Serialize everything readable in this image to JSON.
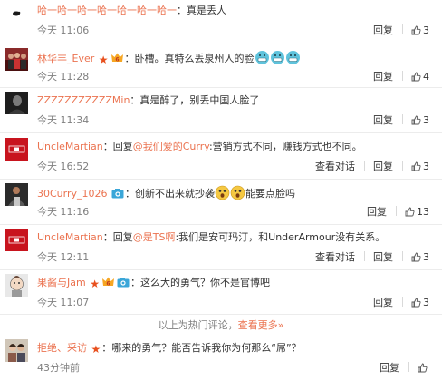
{
  "comments": [
    {
      "user": "哈一哈一哈一哈一哈一哈一哈一",
      "text": "：真是丢人",
      "time": "今天 11:06",
      "reply": "回复",
      "likes": "3",
      "avatar": "white-bird-avatar"
    },
    {
      "user": "林华丰_Ever",
      "text": "：卧槽。真特么丢泉州人的脸",
      "time": "今天 11:28",
      "reply": "回复",
      "likes": "4",
      "avatar": "group-photo-avatar"
    },
    {
      "user": "ZZZZZZZZZZZMin",
      "text": "：真是醉了，别丢中国人脸了",
      "time": "今天 11:34",
      "reply": "回复",
      "likes": "3",
      "avatar": "dark-portrait-avatar"
    },
    {
      "user": "UncleMartian",
      "text_prefix": "：回复",
      "mention": "@我们爱的Curry",
      "text": ":营销方式不同，赚钱方式也不同。",
      "time": "今天 16:52",
      "view_thread": "查看对话",
      "reply": "回复",
      "likes": "3",
      "avatar": "red-logo-avatar"
    },
    {
      "user": "30Curry_1026",
      "text": "：创新不出来就抄袭",
      "text_suffix": "能要点脸吗",
      "time": "今天 11:16",
      "reply": "回复",
      "likes": "13",
      "avatar": "player-avatar"
    },
    {
      "user": "UncleMartian",
      "text_prefix": "：回复",
      "mention": "@是TS啊",
      "text": ":我们是安可玛汀，和UnderArmour没有关系。",
      "time": "今天 12:11",
      "view_thread": "查看对话",
      "reply": "回复",
      "likes": "3",
      "avatar": "red-logo-avatar"
    },
    {
      "user": "果酱与Jam",
      "text": "：这么大的勇气？你不是官博吧",
      "time": "今天 11:07",
      "reply": "回复",
      "likes": "3",
      "avatar": "cartoon-avatar"
    },
    {
      "user": "拒绝、采访",
      "text": "：哪来的勇气？能否告诉我你为何那么“屌”？",
      "time": "43分钟前",
      "reply": "回复",
      "likes": "",
      "avatar": "couple-avatar"
    }
  ],
  "hot_bar": {
    "text": "以上为热门评论，",
    "more": "查看更多",
    "ellipsis": "»"
  },
  "colors": {
    "accent": "#eb7350",
    "muted": "#808080",
    "text": "#333333"
  }
}
